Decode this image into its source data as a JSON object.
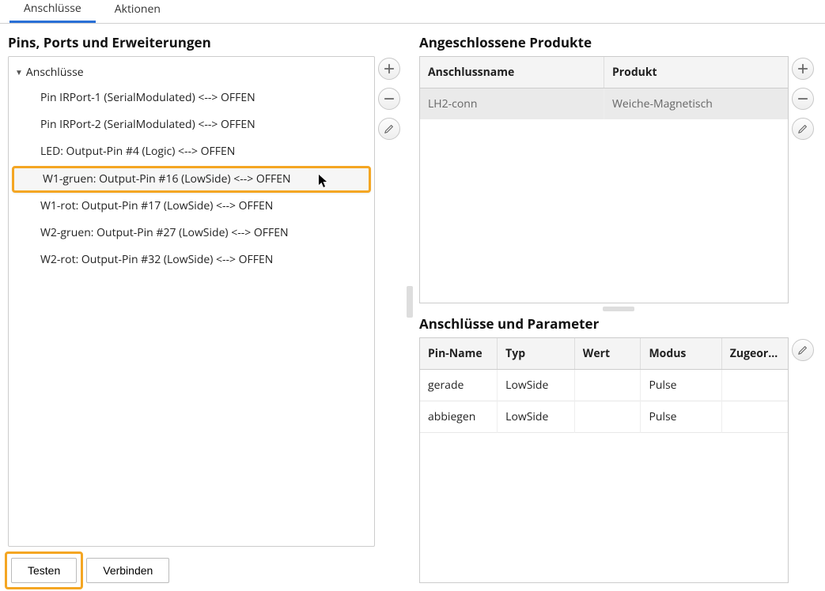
{
  "tabs": {
    "connections": "Anschlüsse",
    "actions": "Aktionen"
  },
  "left": {
    "title": "Pins, Ports und Erweiterungen",
    "root_label": "Anschlüsse",
    "items": [
      "Pin IRPort-1 (SerialModulated) <--> OFFEN",
      "Pin IRPort-2 (SerialModulated) <--> OFFEN",
      "LED: Output-Pin #4 (Logic) <--> OFFEN",
      "W1-gruen: Output-Pin #16 (LowSide) <--> OFFEN",
      "W1-rot: Output-Pin #17 (LowSide) <--> OFFEN",
      "W2-gruen: Output-Pin #27 (LowSide) <--> OFFEN",
      "W2-rot: Output-Pin #32 (LowSide) <--> OFFEN"
    ],
    "highlight_index": 3,
    "buttons": {
      "test": "Testen",
      "connect": "Verbinden"
    }
  },
  "right": {
    "products": {
      "title": "Angeschlossene Produkte",
      "headers": {
        "name": "Anschlussname",
        "product": "Produkt"
      },
      "rows": [
        {
          "name": "LH2-conn",
          "product": "Weiche-Magnetisch"
        }
      ]
    },
    "params": {
      "title": "Anschlüsse und Parameter",
      "headers": {
        "pin": "Pin-Name",
        "type": "Typ",
        "value": "Wert",
        "mode": "Modus",
        "assigned": "Zugeord…"
      },
      "rows": [
        {
          "pin": "gerade",
          "type": "LowSide",
          "value": "",
          "mode": "Pulse",
          "assigned": ""
        },
        {
          "pin": "abbiegen",
          "type": "LowSide",
          "value": "",
          "mode": "Pulse",
          "assigned": ""
        }
      ]
    }
  }
}
